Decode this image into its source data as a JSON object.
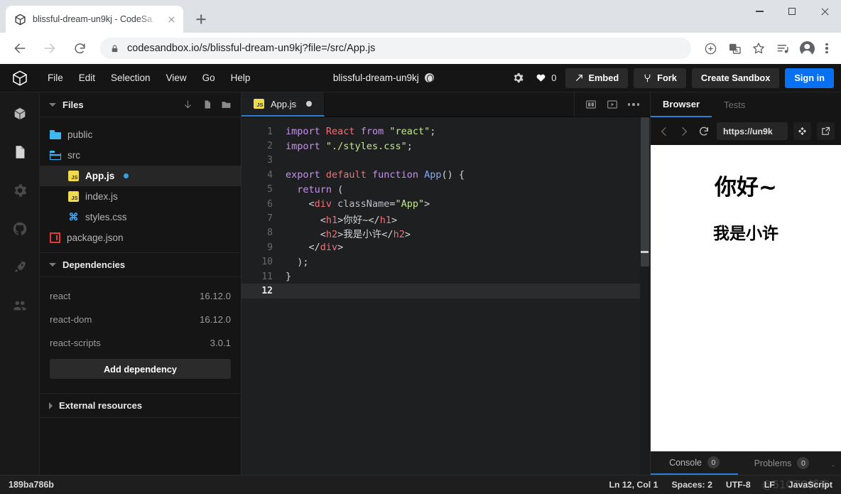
{
  "browser": {
    "tab": {
      "title": "blissful-dream-un9kj - CodeSa",
      "favicon": "codesandbox-cube-icon",
      "close": "close-icon"
    },
    "new_tab": "+",
    "window_controls": {
      "minimize": "minimize-icon",
      "maximize": "maximize-icon",
      "close": "close-icon"
    },
    "nav": {
      "back": "back-arrow-icon",
      "forward": "forward-arrow-icon",
      "reload": "reload-icon"
    },
    "omnibox": {
      "lock": "lock-icon",
      "url": "codesandbox.io/s/blissful-dream-un9kj?file=/src/App.js"
    },
    "toolbar_icons": [
      "add-circle-icon",
      "translate-icon",
      "bookmark-star-icon",
      "reading-list-icon",
      "profile-avatar-icon",
      "chrome-menu-icon"
    ]
  },
  "header": {
    "logo": "codesandbox-logo-icon",
    "menus": [
      "File",
      "Edit",
      "Selection",
      "View",
      "Go",
      "Help"
    ],
    "sandbox_title": "blissful-dream-un9kj",
    "privacy_icon": "globe-icon",
    "settings_icon": "gear-icon",
    "likes": {
      "icon": "heart-icon",
      "count": "0"
    },
    "embed_label": "Embed",
    "embed_icon": "share-arrow-icon",
    "fork_label": "Fork",
    "fork_icon": "fork-icon",
    "create_sandbox_label": "Create Sandbox",
    "sign_in_label": "Sign in",
    "accent_blue": "#0971f1"
  },
  "activity_bar": {
    "items": [
      {
        "name": "sandbox-icon",
        "active": true
      },
      {
        "name": "files-icon",
        "active": true
      },
      {
        "name": "gear-icon",
        "active": false
      },
      {
        "name": "github-icon",
        "active": false
      },
      {
        "name": "rocket-deploy-icon",
        "active": false
      },
      {
        "name": "people-live-icon",
        "active": false
      }
    ]
  },
  "sidebar": {
    "files_panel": {
      "title": "Files",
      "icons": [
        "download-icon",
        "new-file-icon",
        "new-folder-icon"
      ],
      "tree": [
        {
          "label": "public",
          "kind": "folder",
          "indent": 1,
          "selected": false,
          "dirty": false
        },
        {
          "label": "src",
          "kind": "folder-open",
          "indent": 1,
          "selected": false,
          "dirty": false
        },
        {
          "label": "App.js",
          "kind": "js",
          "indent": 2,
          "selected": true,
          "dirty": true
        },
        {
          "label": "index.js",
          "kind": "js",
          "indent": 2,
          "selected": false,
          "dirty": false
        },
        {
          "label": "styles.css",
          "kind": "css",
          "indent": 2,
          "selected": false,
          "dirty": false
        },
        {
          "label": "package.json",
          "kind": "npm",
          "indent": 1,
          "selected": false,
          "dirty": false
        }
      ]
    },
    "dependencies_panel": {
      "title": "Dependencies",
      "items": [
        {
          "name": "react",
          "version": "16.12.0"
        },
        {
          "name": "react-dom",
          "version": "16.12.0"
        },
        {
          "name": "react-scripts",
          "version": "3.0.1"
        }
      ],
      "add_label": "Add dependency"
    },
    "external_resources_panel": {
      "title": "External resources"
    }
  },
  "editor": {
    "tab": {
      "label": "App.js",
      "icon": "js-file-icon",
      "dirty_dot": "unsaved-dot"
    },
    "tab_icons": [
      "split-pane-icon",
      "open-preview-icon",
      "more-options-icon"
    ],
    "lines": [
      {
        "n": "1",
        "tokens": [
          {
            "t": "import",
            "c": "k"
          },
          {
            "t": " ",
            "c": "pun"
          },
          {
            "t": "React",
            "c": "cls"
          },
          {
            "t": " ",
            "c": "pun"
          },
          {
            "t": "from",
            "c": "k"
          },
          {
            "t": " ",
            "c": "pun"
          },
          {
            "t": "\"react\"",
            "c": "str"
          },
          {
            "t": ";",
            "c": "pun"
          }
        ]
      },
      {
        "n": "2",
        "tokens": [
          {
            "t": "import",
            "c": "k"
          },
          {
            "t": " ",
            "c": "pun"
          },
          {
            "t": "\"./styles.css\"",
            "c": "str"
          },
          {
            "t": ";",
            "c": "pun"
          }
        ]
      },
      {
        "n": "3",
        "tokens": []
      },
      {
        "n": "4",
        "tokens": [
          {
            "t": "export",
            "c": "k"
          },
          {
            "t": " ",
            "c": "pun"
          },
          {
            "t": "default",
            "c": "cls"
          },
          {
            "t": " ",
            "c": "pun"
          },
          {
            "t": "function",
            "c": "k"
          },
          {
            "t": " ",
            "c": "pun"
          },
          {
            "t": "App",
            "c": "fn"
          },
          {
            "t": "() {",
            "c": "pun"
          }
        ]
      },
      {
        "n": "5",
        "tokens": [
          {
            "t": "  ",
            "c": "pun"
          },
          {
            "t": "return",
            "c": "k"
          },
          {
            "t": " (",
            "c": "pun"
          }
        ]
      },
      {
        "n": "6",
        "tokens": [
          {
            "t": "    <",
            "c": "pun"
          },
          {
            "t": "div",
            "c": "cls"
          },
          {
            "t": " ",
            "c": "pun"
          },
          {
            "t": "className",
            "c": "attr"
          },
          {
            "t": "=",
            "c": "pun"
          },
          {
            "t": "\"App\"",
            "c": "str"
          },
          {
            "t": ">",
            "c": "pun"
          }
        ]
      },
      {
        "n": "7",
        "tokens": [
          {
            "t": "      <",
            "c": "pun"
          },
          {
            "t": "h1",
            "c": "cls"
          },
          {
            "t": ">",
            "c": "pun"
          },
          {
            "t": "你好~",
            "c": "pun"
          },
          {
            "t": "</",
            "c": "pun"
          },
          {
            "t": "h1",
            "c": "cls"
          },
          {
            "t": ">",
            "c": "pun"
          }
        ]
      },
      {
        "n": "8",
        "tokens": [
          {
            "t": "      <",
            "c": "pun"
          },
          {
            "t": "h2",
            "c": "cls"
          },
          {
            "t": ">",
            "c": "pun"
          },
          {
            "t": "我是小许",
            "c": "pun"
          },
          {
            "t": "</",
            "c": "pun"
          },
          {
            "t": "h2",
            "c": "cls"
          },
          {
            "t": ">",
            "c": "pun"
          }
        ]
      },
      {
        "n": "9",
        "tokens": [
          {
            "t": "    </",
            "c": "pun"
          },
          {
            "t": "div",
            "c": "cls"
          },
          {
            "t": ">",
            "c": "pun"
          }
        ]
      },
      {
        "n": "10",
        "tokens": [
          {
            "t": "  );",
            "c": "pun"
          }
        ]
      },
      {
        "n": "11",
        "tokens": [
          {
            "t": "}",
            "c": "pun"
          }
        ]
      },
      {
        "n": "12",
        "tokens": [],
        "current": true
      }
    ]
  },
  "preview": {
    "tabs": [
      {
        "label": "Browser",
        "active": true
      },
      {
        "label": "Tests",
        "active": false
      }
    ],
    "toolbar": {
      "back": "back-chevron-icon",
      "forward": "forward-chevron-icon",
      "reload": "reload-icon",
      "url": "https://un9k",
      "responsive": "responsive-mode-icon",
      "external": "open-external-icon"
    },
    "content": {
      "h1": "你好~",
      "h2": "我是小许"
    },
    "bottom_tabs": [
      {
        "label": "Console",
        "count": "0",
        "active": true
      },
      {
        "label": "Problems",
        "count": "0",
        "active": false
      }
    ],
    "bottom_more": "more-icon"
  },
  "statusbar": {
    "sandbox_id": "189ba786b",
    "items": [
      "Ln 12, Col 1",
      "Spaces: 2",
      "UTF-8",
      "LF",
      "JavaScript"
    ],
    "watermark": "@51CTO博客"
  }
}
